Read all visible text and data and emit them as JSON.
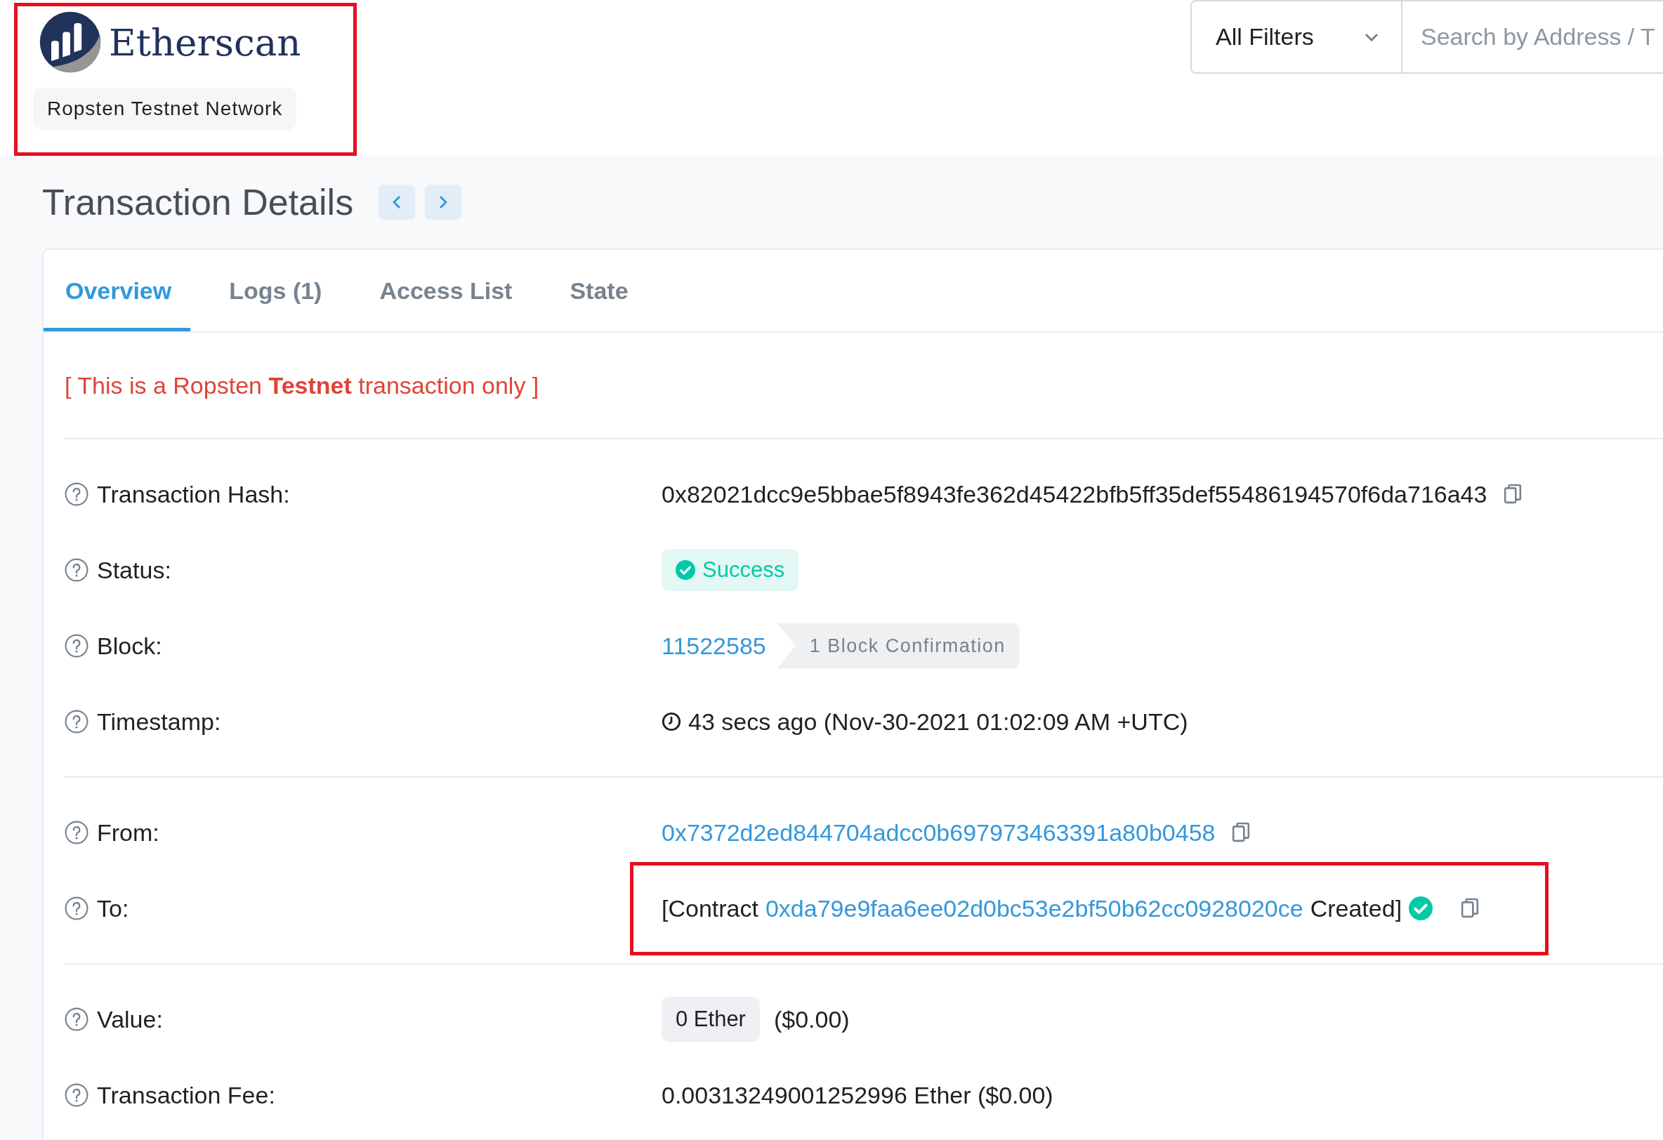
{
  "header": {
    "logo": {
      "text": "Etherscan",
      "highlighted": true
    },
    "network_badge": "Ropsten Testnet Network",
    "filter": {
      "label": "All Filters"
    },
    "search": {
      "placeholder": "Search by Address / T"
    }
  },
  "page_title": "Transaction Details",
  "tabs": [
    {
      "label": "Overview",
      "selected": true
    },
    {
      "label": "Logs (1)",
      "selected": false
    },
    {
      "label": "Access List",
      "selected": false
    },
    {
      "label": "State",
      "selected": false
    }
  ],
  "notice": "[ This is a Ropsten **Testnet** transaction only ]",
  "sections": [
    {
      "rows": [
        {
          "kind": "text",
          "label": "Transaction Hash:",
          "value": "0x82021dcc9e5bbae5f8943fe362d45422bfb5ff35def55486194570f6da716a43",
          "copy": true
        },
        {
          "kind": "status",
          "label": "Status:",
          "value": "Success"
        },
        {
          "kind": "block",
          "label": "Block:",
          "value": "11522585",
          "confirmations": "1 Block Confirmation"
        },
        {
          "kind": "timestamp",
          "label": "Timestamp:",
          "value": "43 secs ago (Nov-30-2021 01:02:09 AM +UTC)"
        }
      ]
    },
    {
      "rows": [
        {
          "kind": "address",
          "label": "From:",
          "value": "0x7372d2ed844704adcc0b697973463391a80b0458",
          "copy": true
        },
        {
          "kind": "contract",
          "label": "To:",
          "prefix": "[Contract",
          "address": "0xda79e9faa6ee02d0bc53e2bf50b62cc0928020ce",
          "suffix": "Created]",
          "verified": true,
          "copy": true,
          "highlighted": true
        }
      ]
    },
    {
      "rows": [
        {
          "kind": "amount",
          "label": "Value:",
          "amount": "0 Ether",
          "fiat": "($0.00)"
        },
        {
          "kind": "text",
          "label": "Transaction Fee:",
          "value": "0.00313249001252996 Ether ($0.00)"
        }
      ]
    }
  ]
}
